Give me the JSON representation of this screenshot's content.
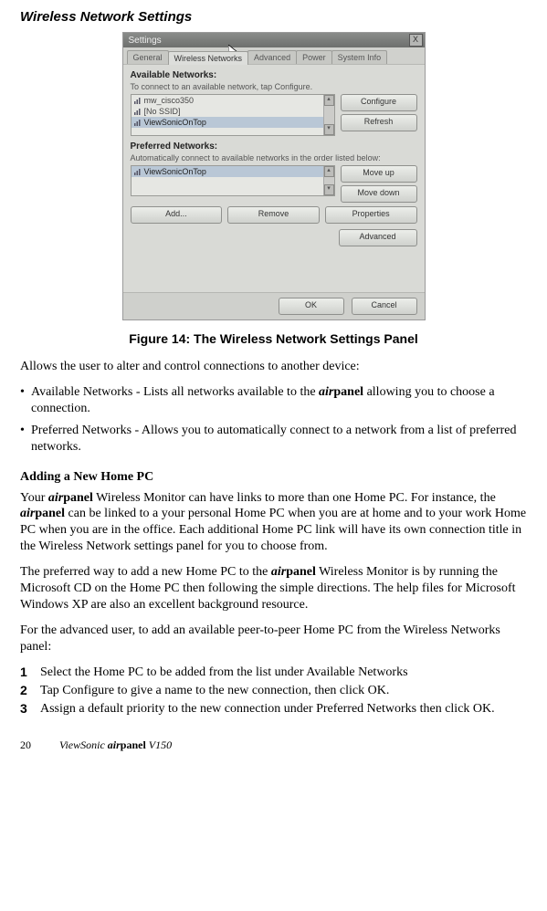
{
  "heading": "Wireless Network Settings",
  "window": {
    "title": "Settings",
    "close_icon": "X",
    "tabs": {
      "general": "General",
      "wireless": "Wireless Networks",
      "advanced": "Advanced",
      "power": "Power",
      "system": "System Info"
    },
    "available": {
      "title": "Available Networks:",
      "sub": "To connect to an available network, tap Configure.",
      "items": [
        "mw_cisco350",
        "[No SSID]",
        "ViewSonicOnTop"
      ],
      "configure": "Configure",
      "refresh": "Refresh"
    },
    "preferred": {
      "title": "Preferred Networks:",
      "sub": "Automatically connect to available networks in the order listed below:",
      "items": [
        "ViewSonicOnTop"
      ],
      "moveup": "Move up",
      "movedown": "Move down",
      "add": "Add...",
      "remove": "Remove",
      "properties": "Properties"
    },
    "advanced_btn": "Advanced",
    "ok": "OK",
    "cancel": "Cancel"
  },
  "caption": "Figure 14: The Wireless Network Settings Panel",
  "intro": "Allows the user to alter and control connections to another device:",
  "bullets": {
    "b1a": "Available Networks - Lists all networks available to the ",
    "b1b": " allowing you to choose a connection.",
    "b2": "Preferred Networks - Allows you to automatically connect to a network from a list of preferred networks."
  },
  "sub1": "Adding a New Home PC",
  "p1a": "Your ",
  "p1b": " Wireless Monitor can have links to more than one Home PC. For instance, the ",
  "p1c": " can be linked to a your personal Home PC when you are at home and to your work Home PC when you are in the office. Each additional Home PC link will have its own connection title in the Wireless Network settings panel for you to choose from.",
  "p2a": "The preferred way to add a new Home PC to the ",
  "p2b": " Wireless Monitor is by running the Microsoft CD on the Home PC then following the simple directions. The help files for Microsoft Windows XP are also an excellent background resource.",
  "p3": "For the advanced user, to add an available peer-to-peer Home PC from the Wireless Networks panel:",
  "steps": {
    "s1": "Select the Home PC to be added from the list under Available Networks",
    "s2": "Tap Configure to give a name to the new connection, then click OK.",
    "s3": "Assign a default priority to the new connection under Preferred Networks then click OK."
  },
  "air": "air",
  "panel": "panel",
  "footer": {
    "page": "20",
    "brand_pre": "ViewSonic ",
    "model": " V150"
  }
}
